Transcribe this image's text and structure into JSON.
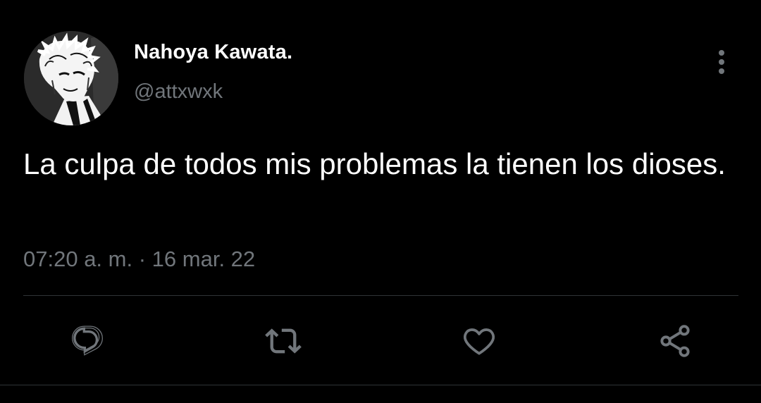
{
  "tweet": {
    "author": {
      "display_name": "Nahoya Kawata.",
      "handle": "@attxwxk",
      "avatar_icon": "avatar-image"
    },
    "text": "La culpa de todos mis problemas la tienen los dioses.",
    "time": "07:20 a. m.",
    "separator": "·",
    "date": "16 mar. 22"
  },
  "actions": [
    {
      "name": "reply",
      "icon": "reply-icon"
    },
    {
      "name": "retweet",
      "icon": "retweet-icon"
    },
    {
      "name": "like",
      "icon": "heart-icon"
    },
    {
      "name": "share",
      "icon": "share-icon"
    }
  ],
  "menu": {
    "icon": "more-vertical-icon"
  },
  "colors": {
    "background": "#000000",
    "text": "#ffffff",
    "secondary_text": "#71767b",
    "icon": "#71767b",
    "divider": "#2f3336"
  }
}
